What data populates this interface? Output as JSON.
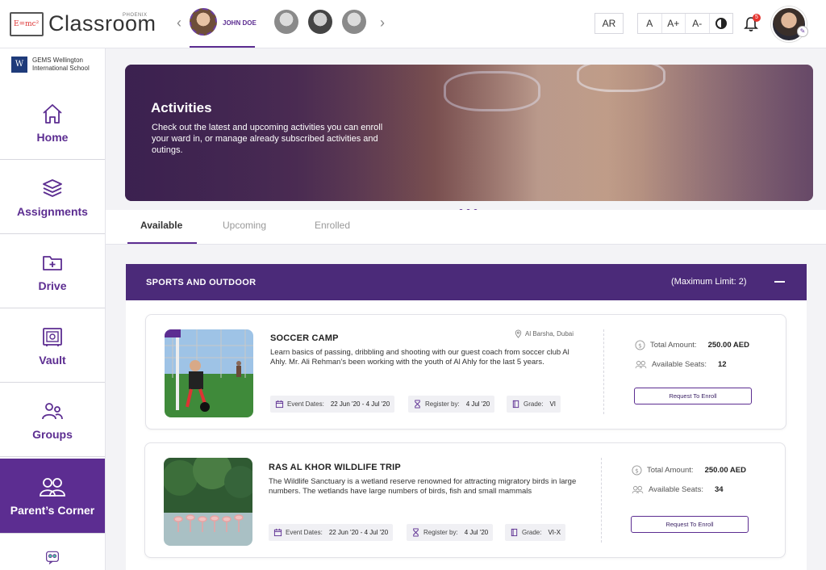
{
  "header": {
    "logo_badge": "E=mc²",
    "logo_text": "Classroom",
    "logo_sub": "PHOENIX",
    "selected_child": "JOHN DOE",
    "language_button": "AR",
    "font_buttons": [
      "A",
      "A+",
      "A-"
    ],
    "notification_count": "5"
  },
  "sidebar": {
    "school_badge": "W",
    "school_name_line1": "GEMS Wellington",
    "school_name_line2": "International School",
    "items": [
      {
        "label": "Home",
        "icon": "home-icon"
      },
      {
        "label": "Assignments",
        "icon": "layers-icon"
      },
      {
        "label": "Drive",
        "icon": "folder-plus-icon"
      },
      {
        "label": "Vault",
        "icon": "vault-icon"
      },
      {
        "label": "Groups",
        "icon": "groups-icon"
      },
      {
        "label": "Parent’s Corner",
        "icon": "parents-icon"
      }
    ]
  },
  "banner": {
    "title": "Activities",
    "text": "Check out the latest and upcoming activities you can enroll your ward in, or manage already subscribed activities and outings."
  },
  "tabs": [
    "Available",
    "Upcoming",
    "Enrolled"
  ],
  "section": {
    "title": "SPORTS AND OUTDOOR",
    "limit": "(Maximum Limit: 2)"
  },
  "activities": [
    {
      "title": "SOCCER CAMP",
      "location": "Al Barsha, Dubai",
      "description": "Learn basics of passing, dribbling and shooting with our guest coach from soccer club Al Ahly. Mr. Ali Rehman’s been working with the youth of Al Ahly for the last 5 years.",
      "event_dates_label": "Event Dates:",
      "event_dates": "22 Jun '20 - 4 Jul '20",
      "register_label": "Register by:",
      "register_by": "4 Jul '20",
      "grade_label": "Grade:",
      "grade": "VI",
      "amount_label": "Total Amount:",
      "amount": "250.00 AED",
      "seats_label": "Available Seats:",
      "seats": "12",
      "button": "Request To Enroll"
    },
    {
      "title": "RAS AL KHOR WILDLIFE TRIP",
      "location": "",
      "description": "The Wildlife Sanctuary is a wetland reserve renowned for attracting migratory birds in large numbers. The wetlands have large numbers of birds, fish and small mammals",
      "event_dates_label": "Event Dates:",
      "event_dates": "22 Jun '20 - 4 Jul '20",
      "register_label": "Register by:",
      "register_by": "4 Jul '20",
      "grade_label": "Grade:",
      "grade": "VI-X",
      "amount_label": "Total Amount:",
      "amount": "250.00 AED",
      "seats_label": "Available Seats:",
      "seats": "34",
      "button": "Request To Enroll"
    }
  ],
  "colors": {
    "brand": "#5c2d91",
    "section_header": "#4b2a79",
    "badge": "#e5342f"
  }
}
